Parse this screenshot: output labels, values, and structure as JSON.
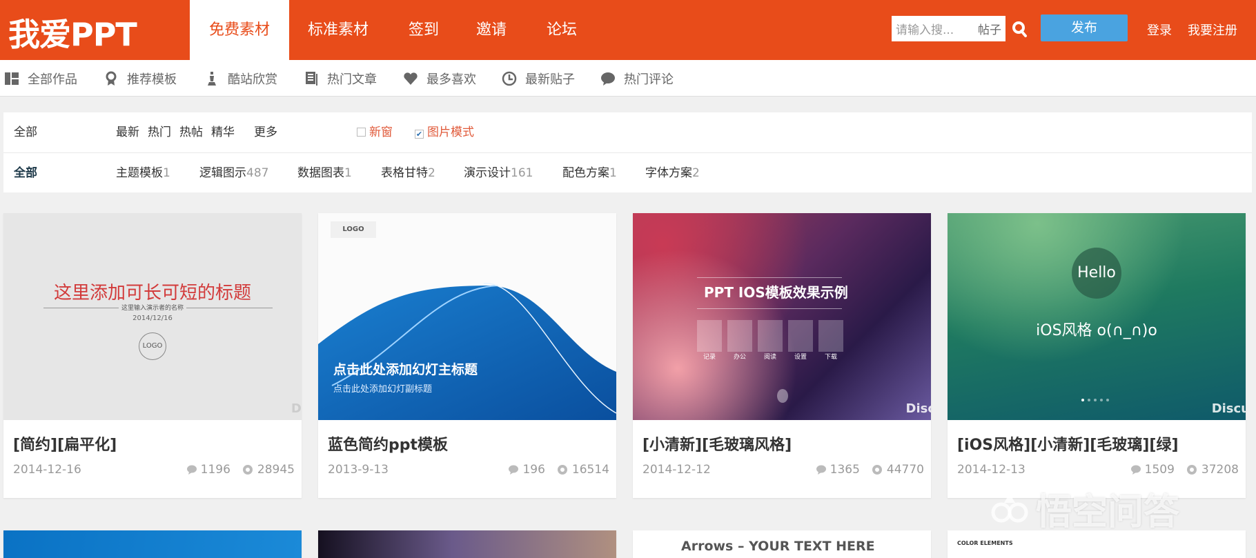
{
  "header": {
    "logo": "我爱PPT",
    "nav": [
      "免费素材",
      "标准素材",
      "签到",
      "邀请",
      "论坛"
    ],
    "active_nav": 0,
    "search": {
      "placeholder": "请输入搜...",
      "scope": "帖子"
    },
    "publish": "发布",
    "login": "登录",
    "register": "我要注册"
  },
  "colors": {
    "brand": "#e84c1a",
    "publish": "#4aa3e0"
  },
  "subnav": [
    {
      "label": "全部作品",
      "icon": "grid-icon"
    },
    {
      "label": "推荐模板",
      "icon": "award-icon"
    },
    {
      "label": "酷站欣赏",
      "icon": "chess-icon"
    },
    {
      "label": "热门文章",
      "icon": "document-icon"
    },
    {
      "label": "最多喜欢",
      "icon": "heart-icon"
    },
    {
      "label": "最新贴子",
      "icon": "clock-icon"
    },
    {
      "label": "热门评论",
      "icon": "comment-icon"
    }
  ],
  "filter": {
    "row1": {
      "label": "全部",
      "sorts": [
        "最新",
        "热门",
        "热帖",
        "精华"
      ],
      "more": "更多",
      "new_window": "新窗",
      "new_window_checked": false,
      "image_mode": "图片模式",
      "image_mode_checked": true
    },
    "row2": {
      "label": "全部",
      "categories": [
        {
          "name": "主题模板",
          "count": "1"
        },
        {
          "name": "逻辑图示",
          "count": "487"
        },
        {
          "name": "数据图表",
          "count": "1"
        },
        {
          "name": "表格甘特",
          "count": "2"
        },
        {
          "name": "演示设计",
          "count": "161"
        },
        {
          "name": "配色方案",
          "count": "1"
        },
        {
          "name": "字体方案",
          "count": "2"
        }
      ]
    }
  },
  "cards": [
    {
      "title": "[简约][扁平化]",
      "date": "2014-12-16",
      "comments": "1196",
      "views": "28945",
      "thumb": {
        "title": "这里添加可长可短的标题",
        "subtitle": "这里输入演示者的名称",
        "date": "2014/12/16",
        "logo": "LOGO",
        "mark": "Di"
      }
    },
    {
      "title": "蓝色简约ppt模板",
      "date": "2013-9-13",
      "comments": "196",
      "views": "16514",
      "thumb": {
        "logo": "LOGO",
        "title": "点击此处添加幻灯主标题",
        "subtitle": "点击此处添加幻灯副标题"
      }
    },
    {
      "title": "[小清新][毛玻璃风格]",
      "date": "2014-12-12",
      "comments": "1365",
      "views": "44770",
      "thumb": {
        "title": "PPT IOS模板效果示例",
        "icons": [
          "记录",
          "办公",
          "阅读",
          "设置",
          "下载"
        ],
        "mark": "Disc"
      }
    },
    {
      "title": "[iOS风格][小清新][毛玻璃][绿]",
      "date": "2014-12-13",
      "comments": "1509",
      "views": "37208",
      "thumb": {
        "badge": "Hello",
        "title": "iOS风格 o(∩_∩)o",
        "mark": "Discu"
      }
    }
  ],
  "cards_row2": [
    {
      "thumb_text": ""
    },
    {
      "thumb_text": ""
    },
    {
      "thumb_text": "Arrows – YOUR TEXT HERE"
    },
    {
      "thumb_text": "COLOR ELEMENTS"
    }
  ],
  "watermark": "悟空问答"
}
